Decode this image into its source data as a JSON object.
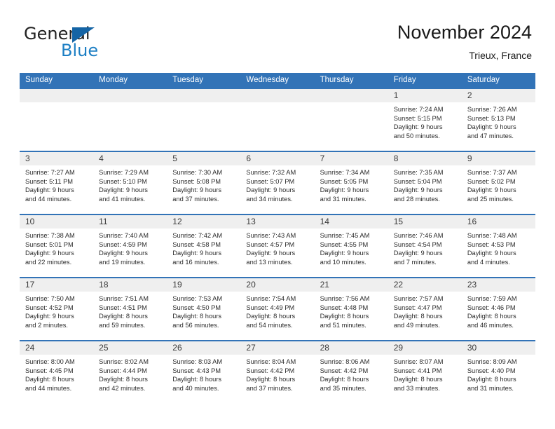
{
  "brand": {
    "name_part1": "General",
    "name_part2": "Blue",
    "triangle_color": "#1464a5",
    "blue_color": "#1d7fc4"
  },
  "header": {
    "month_title": "November 2024",
    "location": "Trieux, France"
  },
  "theme": {
    "header_blue": "#3273b7",
    "day_band_gray": "#efefef"
  },
  "weekdays": [
    "Sunday",
    "Monday",
    "Tuesday",
    "Wednesday",
    "Thursday",
    "Friday",
    "Saturday"
  ],
  "weeks": [
    [
      {
        "day": "",
        "sunrise": "",
        "sunset": "",
        "daylight_line1": "",
        "daylight_line2": "",
        "empty": true
      },
      {
        "day": "",
        "sunrise": "",
        "sunset": "",
        "daylight_line1": "",
        "daylight_line2": "",
        "empty": true
      },
      {
        "day": "",
        "sunrise": "",
        "sunset": "",
        "daylight_line1": "",
        "daylight_line2": "",
        "empty": true
      },
      {
        "day": "",
        "sunrise": "",
        "sunset": "",
        "daylight_line1": "",
        "daylight_line2": "",
        "empty": true
      },
      {
        "day": "",
        "sunrise": "",
        "sunset": "",
        "daylight_line1": "",
        "daylight_line2": "",
        "empty": true
      },
      {
        "day": "1",
        "sunrise": "Sunrise: 7:24 AM",
        "sunset": "Sunset: 5:15 PM",
        "daylight_line1": "Daylight: 9 hours",
        "daylight_line2": "and 50 minutes.",
        "empty": false
      },
      {
        "day": "2",
        "sunrise": "Sunrise: 7:26 AM",
        "sunset": "Sunset: 5:13 PM",
        "daylight_line1": "Daylight: 9 hours",
        "daylight_line2": "and 47 minutes.",
        "empty": false
      }
    ],
    [
      {
        "day": "3",
        "sunrise": "Sunrise: 7:27 AM",
        "sunset": "Sunset: 5:11 PM",
        "daylight_line1": "Daylight: 9 hours",
        "daylight_line2": "and 44 minutes.",
        "empty": false
      },
      {
        "day": "4",
        "sunrise": "Sunrise: 7:29 AM",
        "sunset": "Sunset: 5:10 PM",
        "daylight_line1": "Daylight: 9 hours",
        "daylight_line2": "and 41 minutes.",
        "empty": false
      },
      {
        "day": "5",
        "sunrise": "Sunrise: 7:30 AM",
        "sunset": "Sunset: 5:08 PM",
        "daylight_line1": "Daylight: 9 hours",
        "daylight_line2": "and 37 minutes.",
        "empty": false
      },
      {
        "day": "6",
        "sunrise": "Sunrise: 7:32 AM",
        "sunset": "Sunset: 5:07 PM",
        "daylight_line1": "Daylight: 9 hours",
        "daylight_line2": "and 34 minutes.",
        "empty": false
      },
      {
        "day": "7",
        "sunrise": "Sunrise: 7:34 AM",
        "sunset": "Sunset: 5:05 PM",
        "daylight_line1": "Daylight: 9 hours",
        "daylight_line2": "and 31 minutes.",
        "empty": false
      },
      {
        "day": "8",
        "sunrise": "Sunrise: 7:35 AM",
        "sunset": "Sunset: 5:04 PM",
        "daylight_line1": "Daylight: 9 hours",
        "daylight_line2": "and 28 minutes.",
        "empty": false
      },
      {
        "day": "9",
        "sunrise": "Sunrise: 7:37 AM",
        "sunset": "Sunset: 5:02 PM",
        "daylight_line1": "Daylight: 9 hours",
        "daylight_line2": "and 25 minutes.",
        "empty": false
      }
    ],
    [
      {
        "day": "10",
        "sunrise": "Sunrise: 7:38 AM",
        "sunset": "Sunset: 5:01 PM",
        "daylight_line1": "Daylight: 9 hours",
        "daylight_line2": "and 22 minutes.",
        "empty": false
      },
      {
        "day": "11",
        "sunrise": "Sunrise: 7:40 AM",
        "sunset": "Sunset: 4:59 PM",
        "daylight_line1": "Daylight: 9 hours",
        "daylight_line2": "and 19 minutes.",
        "empty": false
      },
      {
        "day": "12",
        "sunrise": "Sunrise: 7:42 AM",
        "sunset": "Sunset: 4:58 PM",
        "daylight_line1": "Daylight: 9 hours",
        "daylight_line2": "and 16 minutes.",
        "empty": false
      },
      {
        "day": "13",
        "sunrise": "Sunrise: 7:43 AM",
        "sunset": "Sunset: 4:57 PM",
        "daylight_line1": "Daylight: 9 hours",
        "daylight_line2": "and 13 minutes.",
        "empty": false
      },
      {
        "day": "14",
        "sunrise": "Sunrise: 7:45 AM",
        "sunset": "Sunset: 4:55 PM",
        "daylight_line1": "Daylight: 9 hours",
        "daylight_line2": "and 10 minutes.",
        "empty": false
      },
      {
        "day": "15",
        "sunrise": "Sunrise: 7:46 AM",
        "sunset": "Sunset: 4:54 PM",
        "daylight_line1": "Daylight: 9 hours",
        "daylight_line2": "and 7 minutes.",
        "empty": false
      },
      {
        "day": "16",
        "sunrise": "Sunrise: 7:48 AM",
        "sunset": "Sunset: 4:53 PM",
        "daylight_line1": "Daylight: 9 hours",
        "daylight_line2": "and 4 minutes.",
        "empty": false
      }
    ],
    [
      {
        "day": "17",
        "sunrise": "Sunrise: 7:50 AM",
        "sunset": "Sunset: 4:52 PM",
        "daylight_line1": "Daylight: 9 hours",
        "daylight_line2": "and 2 minutes.",
        "empty": false
      },
      {
        "day": "18",
        "sunrise": "Sunrise: 7:51 AM",
        "sunset": "Sunset: 4:51 PM",
        "daylight_line1": "Daylight: 8 hours",
        "daylight_line2": "and 59 minutes.",
        "empty": false
      },
      {
        "day": "19",
        "sunrise": "Sunrise: 7:53 AM",
        "sunset": "Sunset: 4:50 PM",
        "daylight_line1": "Daylight: 8 hours",
        "daylight_line2": "and 56 minutes.",
        "empty": false
      },
      {
        "day": "20",
        "sunrise": "Sunrise: 7:54 AM",
        "sunset": "Sunset: 4:49 PM",
        "daylight_line1": "Daylight: 8 hours",
        "daylight_line2": "and 54 minutes.",
        "empty": false
      },
      {
        "day": "21",
        "sunrise": "Sunrise: 7:56 AM",
        "sunset": "Sunset: 4:48 PM",
        "daylight_line1": "Daylight: 8 hours",
        "daylight_line2": "and 51 minutes.",
        "empty": false
      },
      {
        "day": "22",
        "sunrise": "Sunrise: 7:57 AM",
        "sunset": "Sunset: 4:47 PM",
        "daylight_line1": "Daylight: 8 hours",
        "daylight_line2": "and 49 minutes.",
        "empty": false
      },
      {
        "day": "23",
        "sunrise": "Sunrise: 7:59 AM",
        "sunset": "Sunset: 4:46 PM",
        "daylight_line1": "Daylight: 8 hours",
        "daylight_line2": "and 46 minutes.",
        "empty": false
      }
    ],
    [
      {
        "day": "24",
        "sunrise": "Sunrise: 8:00 AM",
        "sunset": "Sunset: 4:45 PM",
        "daylight_line1": "Daylight: 8 hours",
        "daylight_line2": "and 44 minutes.",
        "empty": false
      },
      {
        "day": "25",
        "sunrise": "Sunrise: 8:02 AM",
        "sunset": "Sunset: 4:44 PM",
        "daylight_line1": "Daylight: 8 hours",
        "daylight_line2": "and 42 minutes.",
        "empty": false
      },
      {
        "day": "26",
        "sunrise": "Sunrise: 8:03 AM",
        "sunset": "Sunset: 4:43 PM",
        "daylight_line1": "Daylight: 8 hours",
        "daylight_line2": "and 40 minutes.",
        "empty": false
      },
      {
        "day": "27",
        "sunrise": "Sunrise: 8:04 AM",
        "sunset": "Sunset: 4:42 PM",
        "daylight_line1": "Daylight: 8 hours",
        "daylight_line2": "and 37 minutes.",
        "empty": false
      },
      {
        "day": "28",
        "sunrise": "Sunrise: 8:06 AM",
        "sunset": "Sunset: 4:42 PM",
        "daylight_line1": "Daylight: 8 hours",
        "daylight_line2": "and 35 minutes.",
        "empty": false
      },
      {
        "day": "29",
        "sunrise": "Sunrise: 8:07 AM",
        "sunset": "Sunset: 4:41 PM",
        "daylight_line1": "Daylight: 8 hours",
        "daylight_line2": "and 33 minutes.",
        "empty": false
      },
      {
        "day": "30",
        "sunrise": "Sunrise: 8:09 AM",
        "sunset": "Sunset: 4:40 PM",
        "daylight_line1": "Daylight: 8 hours",
        "daylight_line2": "and 31 minutes.",
        "empty": false
      }
    ]
  ]
}
